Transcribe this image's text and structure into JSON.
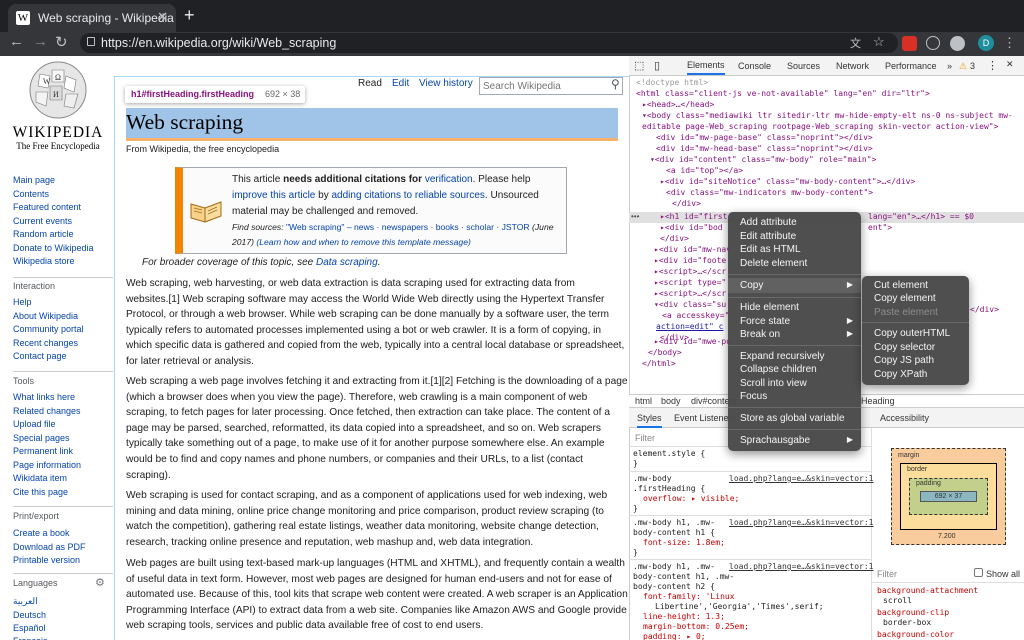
{
  "browser": {
    "tab_title": "Web scraping - Wikipedia",
    "tab_favicon": "W",
    "url": "https://en.wikipedia.org/wiki/Web_scraping",
    "profile_initial": "D"
  },
  "wiki": {
    "wordmark": "WIKIPEDIA",
    "tagline": "The Free Encyclopedia",
    "nav": [
      "Main page",
      "Contents",
      "Featured content",
      "Current events",
      "Random article",
      "Donate to Wikipedia",
      "Wikipedia store"
    ],
    "interaction_head": "Interaction",
    "interaction": [
      "Help",
      "About Wikipedia",
      "Community portal",
      "Recent changes",
      "Contact page"
    ],
    "tools_head": "Tools",
    "tools": [
      "What links here",
      "Related changes",
      "Upload file",
      "Special pages",
      "Permanent link",
      "Page information",
      "Wikidata item",
      "Cite this page"
    ],
    "print_head": "Print/export",
    "print": [
      "Create a book",
      "Download as PDF",
      "Printable version"
    ],
    "languages_head": "Languages",
    "languages": [
      "العربية",
      "Deutsch",
      "Español",
      "Français"
    ],
    "views": {
      "read": "Read",
      "edit": "Edit",
      "history": "View history"
    },
    "search_placeholder": "Search Wikipedia",
    "title": "Web scraping",
    "from": "From Wikipedia, the free encyclopedia",
    "tooltip": {
      "selector": "h1#firstHeading.firstHeading",
      "size": "692 × 38"
    },
    "ambox": {
      "l1a": "This article ",
      "l1b": "needs additional citations for ",
      "l1c": "verification",
      ". ": "",
      "l1d": ". Please help",
      "l2a": "improve this article",
      "l2b": " by ",
      "l2c": "adding citations to reliable sources",
      "l2d": ". Unsourced",
      "l3": "material may be challenged and removed.",
      "l4a": "Find sources: ",
      "l4b": "\"Web scraping\" – news · newspapers · books · scholar · JSTOR",
      "l4c": " (June",
      "l5a": "2017) ",
      "l5b": "(Learn how and when to remove this template message)"
    },
    "hatnote_a": "For broader coverage of this topic, see ",
    "hatnote_b": "Data scraping",
    "hatnote_c": ".",
    "paras": [
      [
        "Web scraping, web harvesting, or web data extraction is data scraping used for extracting data from",
        "websites.[1] Web scraping software may access the World Wide Web directly using the Hypertext Transfer",
        "Protocol, or through a web browser. While web scraping can be done manually by a software user, the term",
        "typically refers to automated processes implemented using a bot or web crawler. It is a form of copying, in",
        "which specific data is gathered and copied from the web, typically into a central local database or spreadsheet,",
        "for later retrieval or analysis."
      ],
      [
        "Web scraping a web page involves fetching it and extracting from it.[1][2] Fetching is the downloading of a page",
        "(which a browser does when you view the page). Therefore, web crawling is a main component of web",
        "scraping, to fetch pages for later processing. Once fetched, then extraction can take place. The content of a",
        "page may be parsed, searched, reformatted, its data copied into a spreadsheet, and so on. Web scrapers",
        "typically take something out of a page, to make use of it for another purpose somewhere else. An example",
        "would be to find and copy names and phone numbers, or companies and their URLs, to a list (contact",
        "scraping)."
      ],
      [
        "Web scraping is used for contact scraping, and as a component of applications used for web indexing, web",
        "mining and data mining, online price change monitoring and price comparison, product review scraping (to",
        "watch the competition), gathering real estate listings, weather data monitoring, website change detection,",
        "research, tracking online presence and reputation, web mashup and, web data integration."
      ],
      [
        "Web pages are built using text-based mark-up languages (HTML and XHTML), and frequently contain a wealth",
        "of useful data in text form. However, most web pages are designed for human end-users and not for ease of",
        "automated use. Because of this, tool kits that scrape web content were created. A web scraper is an Application",
        "Programming Interface (API) to extract data from a web site. Companies like Amazon AWS and Google provide",
        "web scraping tools, services and public data available free of cost to end users."
      ]
    ]
  },
  "devtools": {
    "tabs": [
      "Elements",
      "Console",
      "Sources",
      "Network",
      "Performance",
      "»"
    ],
    "warn_count": "3",
    "dom": [
      "<!doctype html>",
      "<html class=\"client-js ve-not-available\" lang=\"en\" dir=\"ltr\">",
      "▸<head>…</head>",
      "▾<body class=\"mediawiki ltr sitedir-ltr mw-hide-empty-elt ns-0 ns-subject mw-",
      "editable page-Web_scraping rootpage-Web_scraping skin-vector action-view\">",
      "<div id=\"mw-page-base\" class=\"noprint\"></div>",
      "<div id=\"mw-head-base\" class=\"noprint\"></div>",
      "▾<div id=\"content\" class=\"mw-body\" role=\"main\">",
      "<a id=\"top\"></a>",
      "▸<div id=\"siteNotice\" class=\"mw-body-content\">…</div>",
      "<div class=\"mw-indicators mw-body-content\">",
      "</div>",
      "▸<h1 id=\"first",
      "▸<div id=\"bod",
      "</div>",
      "▸<div id=\"mw-nav",
      "▸<div id=\"foote",
      "▸<script>…</scr",
      "▸<script type=\"",
      "▸<script>…</scr",
      "▾<div class=\"su",
      "<a accesskey=\"",
      "action=edit\" c",
      "</div>",
      "▸<div id=\"mwe-po",
      "</body>",
      "</html>"
    ],
    "h1_tail": "lang=\"en\">…</h1> == $0",
    "body_tail": "ent\">",
    "div_tail": "</div>",
    "crumbs": [
      "html",
      "body",
      "div#content",
      "...",
      "Heading"
    ],
    "subtabs": [
      "Styles",
      "Event Listeners",
      "Accessibility"
    ],
    "filter": "Filter",
    "styles": {
      "element_style": "element.style {",
      "r1_sel": ".mw-body",
      "r1_sel2": ".firstHeading {",
      "r1_prop": "overflow: ▸ visible;",
      "r1_src": "load.php?lang=e…&skin=vector:1",
      "r2_sel": ".mw-body h1, .mw-",
      "r2_sel2": "body-content h1 {",
      "r2_prop": "font-size: 1.8em;",
      "r2_src": "load.php?lang=e…&skin=vector:1",
      "r3_sel": ".mw-body h1, .mw-",
      "r3_sel2": "body-content h1, .mw-",
      "r3_sel3": "body-content h2 {",
      "r3_props": [
        "font-family: 'Linux",
        "Libertine','Georgia','Times',serif;",
        "line-height: 1.3;",
        "margin-bottom: 0.25em;",
        "padding: ▸ 0;"
      ],
      "r3_src": "load.php?lang=e…&skin=vector:1"
    },
    "box": {
      "margin": "margin",
      "border": "border",
      "padding": "padding",
      "content": "692 × 37",
      "width": "7.200"
    },
    "computed_filter": "Filter",
    "show_all": "Show all",
    "computed": [
      {
        "name": "background-attachment",
        "value": "scroll"
      },
      {
        "name": "background-clip",
        "value": "border-box"
      },
      {
        "name": "background-color",
        "value": ""
      }
    ],
    "colors": {
      "accent": "#1a73e8",
      "margin": "#f9cc9d",
      "border": "#fddd9b",
      "padding": "#c3d08b",
      "content": "#8cb6c0"
    }
  },
  "context_menu": {
    "items": [
      "Add attribute",
      "Edit attribute",
      "Edit as HTML",
      "Delete element",
      "Copy",
      "Hide element",
      "Force state",
      "Break on",
      "Expand recursively",
      "Collapse children",
      "Scroll into view",
      "Focus",
      "Store as global variable",
      "Sprachausgabe"
    ],
    "copy_submenu": [
      "Cut element",
      "Copy element",
      "Paste element",
      "Copy outerHTML",
      "Copy selector",
      "Copy JS path",
      "Copy XPath"
    ]
  }
}
